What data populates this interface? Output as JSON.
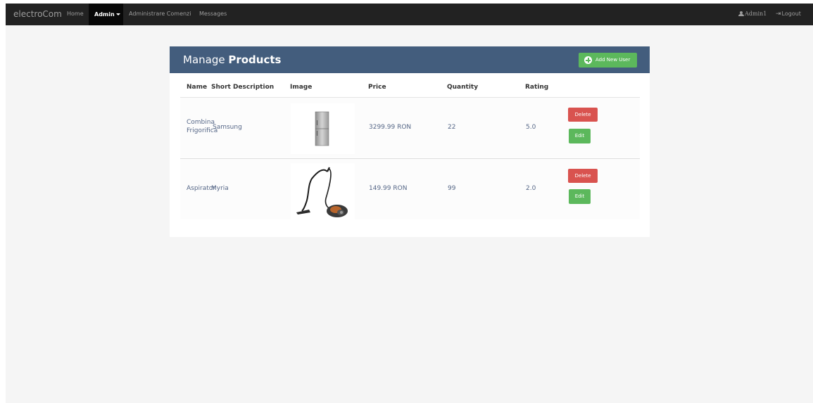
{
  "navbar": {
    "brand": "electroCom",
    "links": [
      "Home",
      "Admin",
      "Administrare Comenzi",
      "Messages"
    ],
    "active": "Admin",
    "user": "Admin1",
    "logout": "Logout"
  },
  "panel": {
    "title_light": "Manage ",
    "title_bold": "Products",
    "add_button": "Add New User"
  },
  "table": {
    "headers": [
      "Name",
      "Short Description",
      "Image",
      "Price",
      "Quantity",
      "Rating"
    ],
    "rows": [
      {
        "name_line1": "Combina",
        "name_line2": "Frigorifica",
        "description": "Samsung",
        "image": "refrigerator-image",
        "price": "3299.99 RON",
        "quantity": "22",
        "rating": "5.0",
        "delete": "Delete",
        "edit": "Edit"
      },
      {
        "name": "Aspirator",
        "description": "Myria",
        "image": "vacuum-cleaner-image",
        "price": "149.99 RON",
        "quantity": "99",
        "rating": "2.0",
        "delete": "Delete",
        "edit": "Edit"
      }
    ]
  },
  "icons": [
    "user-icon",
    "logout-icon",
    "plus-circle-icon",
    "caret-down-icon"
  ],
  "colors": {
    "navbar": "#222222",
    "panel_header": "#435d7d",
    "success": "#5cb85c",
    "danger": "#d9534f",
    "text": "#566787",
    "background": "#f5f5f5"
  }
}
